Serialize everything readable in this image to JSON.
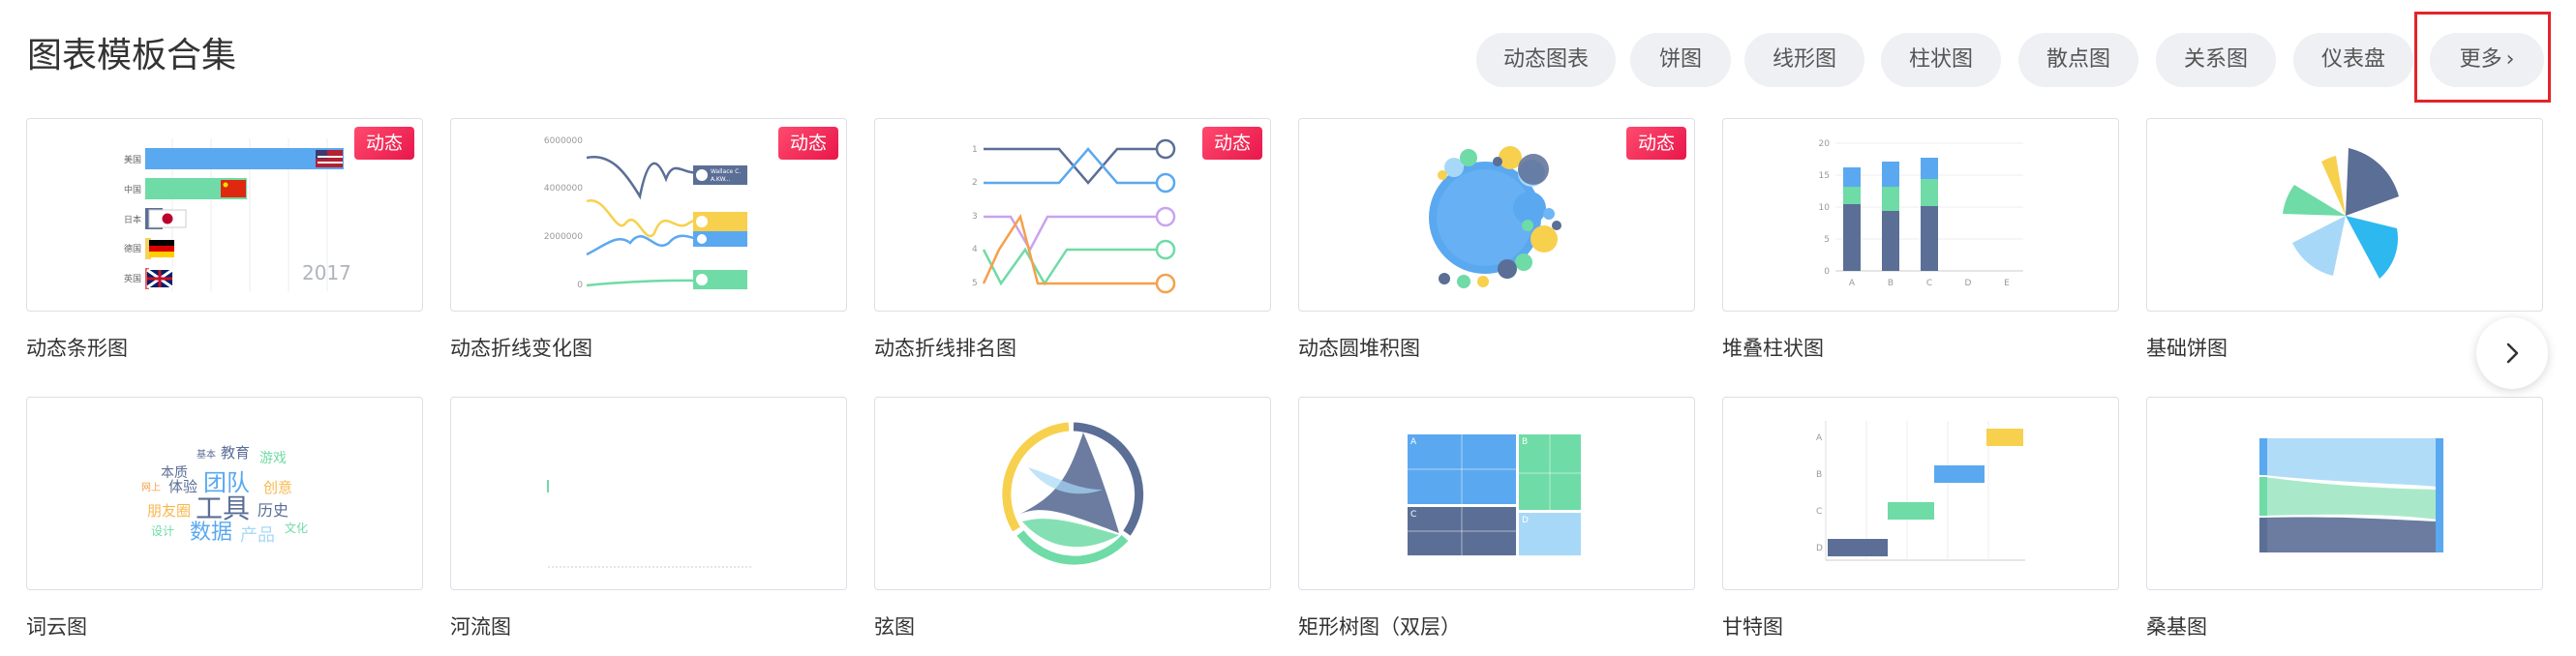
{
  "page": {
    "title": "图表模板合集"
  },
  "filters": [
    "动态图表",
    "饼图",
    "线形图",
    "柱状图",
    "散点图",
    "关系图",
    "仪表盘"
  ],
  "more": {
    "label": "更多"
  },
  "icons": {
    "more": "chevron-right-icon",
    "next": "chevron-right-icon"
  },
  "colors": {
    "badge": "#e8174b",
    "highlight_outline": "#e3242b",
    "chip_bg": "#eef0f3"
  },
  "badge_label": "动态",
  "cards": [
    {
      "label": "动态条形图",
      "badge": true
    },
    {
      "label": "动态折线变化图",
      "badge": true
    },
    {
      "label": "动态折线排名图",
      "badge": true
    },
    {
      "label": "动态圆堆积图",
      "badge": true
    },
    {
      "label": "堆叠柱状图",
      "badge": false
    },
    {
      "label": "基础饼图",
      "badge": false
    },
    {
      "label": "词云图",
      "badge": false
    },
    {
      "label": "河流图",
      "badge": false
    },
    {
      "label": "弦图",
      "badge": false
    },
    {
      "label": "矩形树图（双层）",
      "badge": false
    },
    {
      "label": "甘特图",
      "badge": false
    },
    {
      "label": "桑基图",
      "badge": false
    }
  ],
  "thumbs": {
    "bar_race": {
      "categories": [
        "美国",
        "中国",
        "日本",
        "德国",
        "英国"
      ],
      "year": "2017"
    },
    "line_race": {
      "yticks": [
        "6000000",
        "4000000",
        "2000000",
        "0"
      ],
      "tags": [
        "Wallace C.",
        "A.KW..."
      ]
    },
    "stacked_bar": {
      "yticks": [
        "20",
        "15",
        "10",
        "5",
        "0"
      ],
      "xticks": [
        "A",
        "B",
        "C",
        "D",
        "E"
      ]
    },
    "word_cloud": [
      "基本",
      "教育",
      "游戏",
      "本质",
      "团队",
      "网上",
      "体验",
      "创意",
      "工具",
      "朋友圈",
      "历史",
      "设计",
      "数据",
      "产品",
      "文化"
    ],
    "gantt": {
      "yticks": [
        "A",
        "B",
        "C",
        "D"
      ]
    },
    "treemap": {
      "labels": [
        "A",
        "B",
        "C",
        "D"
      ]
    }
  }
}
